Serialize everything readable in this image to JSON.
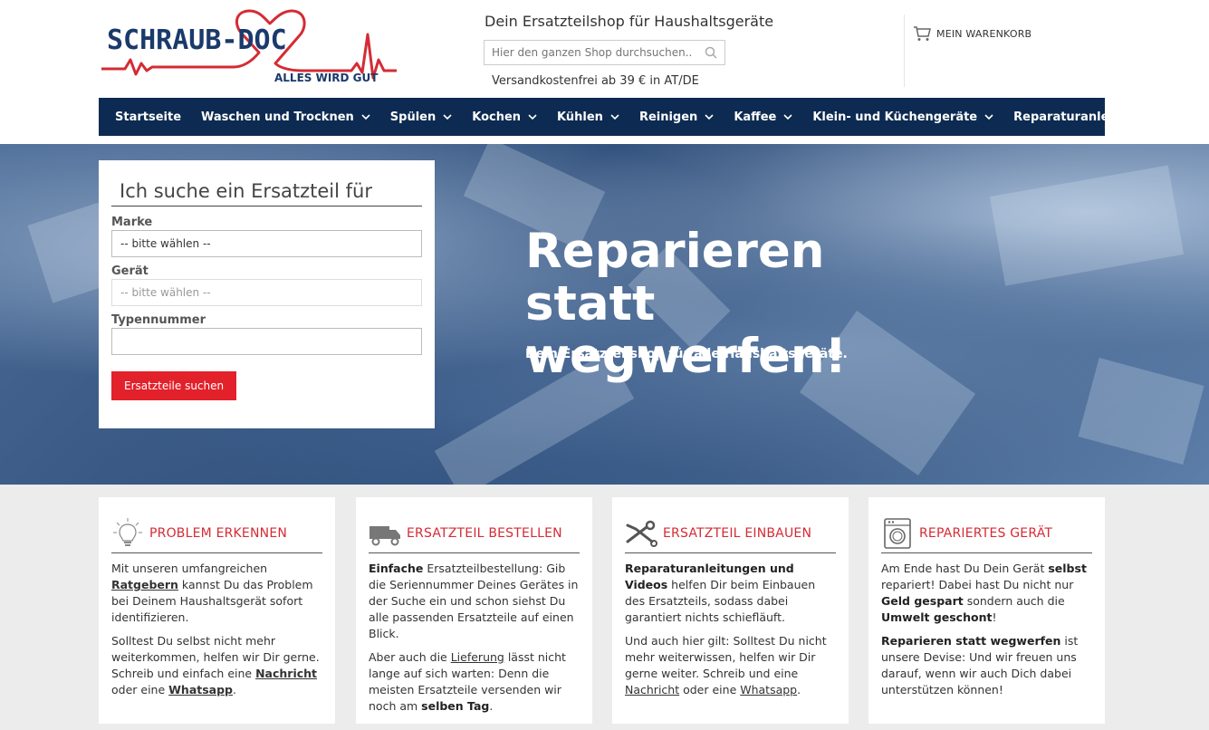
{
  "header": {
    "logo_brand": "SCHRAUB-DOC",
    "logo_slogan": "ALLES WIRD GUT",
    "tagline": "Dein Ersatzteilshop für Haushaltsgeräte",
    "search_placeholder": "Hier den ganzen Shop durchsuchen...",
    "shipping_note": "Versandkostenfrei ab 39 € in AT/DE",
    "cart_label": "MEIN WARENKORB"
  },
  "nav": {
    "items": [
      {
        "label": "Startseite",
        "has_dropdown": false
      },
      {
        "label": "Waschen und Trocknen",
        "has_dropdown": true
      },
      {
        "label": "Spülen",
        "has_dropdown": true
      },
      {
        "label": "Kochen",
        "has_dropdown": true
      },
      {
        "label": "Kühlen",
        "has_dropdown": true
      },
      {
        "label": "Reinigen",
        "has_dropdown": true
      },
      {
        "label": "Kaffee",
        "has_dropdown": true
      },
      {
        "label": "Klein- und Küchengeräte",
        "has_dropdown": true
      },
      {
        "label": "Reparaturanleitungen",
        "has_dropdown": false
      }
    ]
  },
  "hero": {
    "title": "Reparieren statt wegwerfen!",
    "subtitle": "Dein Ersatzteilshop für alle Haushaltsgeräte."
  },
  "finder": {
    "title": "Ich suche ein Ersatzteil für",
    "brand_label": "Marke",
    "brand_value": "-- bitte wählen --",
    "device_label": "Gerät",
    "device_value": "-- bitte wählen --",
    "type_label": "Typennummer",
    "type_value": "",
    "button_label": "Ersatzteile suchen"
  },
  "cards": [
    {
      "icon": "lightbulb-icon",
      "title": "PROBLEM ERKENNEN",
      "p1": [
        "Mit unseren umfangreichen ",
        "Ratgebern",
        " kannst Du das Problem bei Deinem Haushaltsgerät sofort identifizieren."
      ],
      "p2": [
        "Solltest Du selbst nicht mehr weiterkommen, helfen wir Dir gerne. Schreib und einfach eine ",
        "Nachricht",
        " oder eine ",
        "Whatsapp",
        "."
      ]
    },
    {
      "icon": "truck-icon",
      "title": "ERSATZTEIL BESTELLEN",
      "p1": [
        "Einfache",
        " Ersatzteilbestellung: Gib die Seriennummer Deines Gerätes in der Suche ein und schon siehst Du alle passenden Ersatzteile auf einen Blick."
      ],
      "p2": [
        "Aber auch die ",
        "Lieferung",
        " lässt nicht lange auf sich warten: Denn die meisten Ersatzteile versenden wir noch am ",
        "selben Tag",
        "."
      ]
    },
    {
      "icon": "tools-icon",
      "title": "ERSATZTEIL EINBAUEN",
      "p1": [
        "Reparaturanleitungen und Videos",
        " helfen Dir beim Einbauen des Ersatzteils, sodass dabei garantiert nichts schiefläuft."
      ],
      "p2": [
        "Und auch hier gilt: Solltest Du nicht mehr weiterwissen, helfen wir Dir gerne weiter. Schreib und eine ",
        "Nachricht",
        " oder eine ",
        "Whatsapp",
        "."
      ]
    },
    {
      "icon": "washing-machine-icon",
      "title": "REPARIERTES GERÄT",
      "p1": [
        "Am Ende hast Du Dein Gerät ",
        "selbst",
        " repariert! Dabei hast Du nicht nur ",
        "Geld gespart",
        " sondern auch die ",
        "Umwelt geschont",
        "!"
      ],
      "p2": [
        "Reparieren statt wegwerfen",
        " ist unsere Devise: Und wir freuen uns darauf, wenn wir auch Dich dabei unterstützen können!"
      ]
    }
  ],
  "colors": {
    "nav_bg": "#0d2b52",
    "accent_red": "#e2212b",
    "card_title_red": "#d52b34",
    "logo_blue": "#1a3a6b"
  }
}
